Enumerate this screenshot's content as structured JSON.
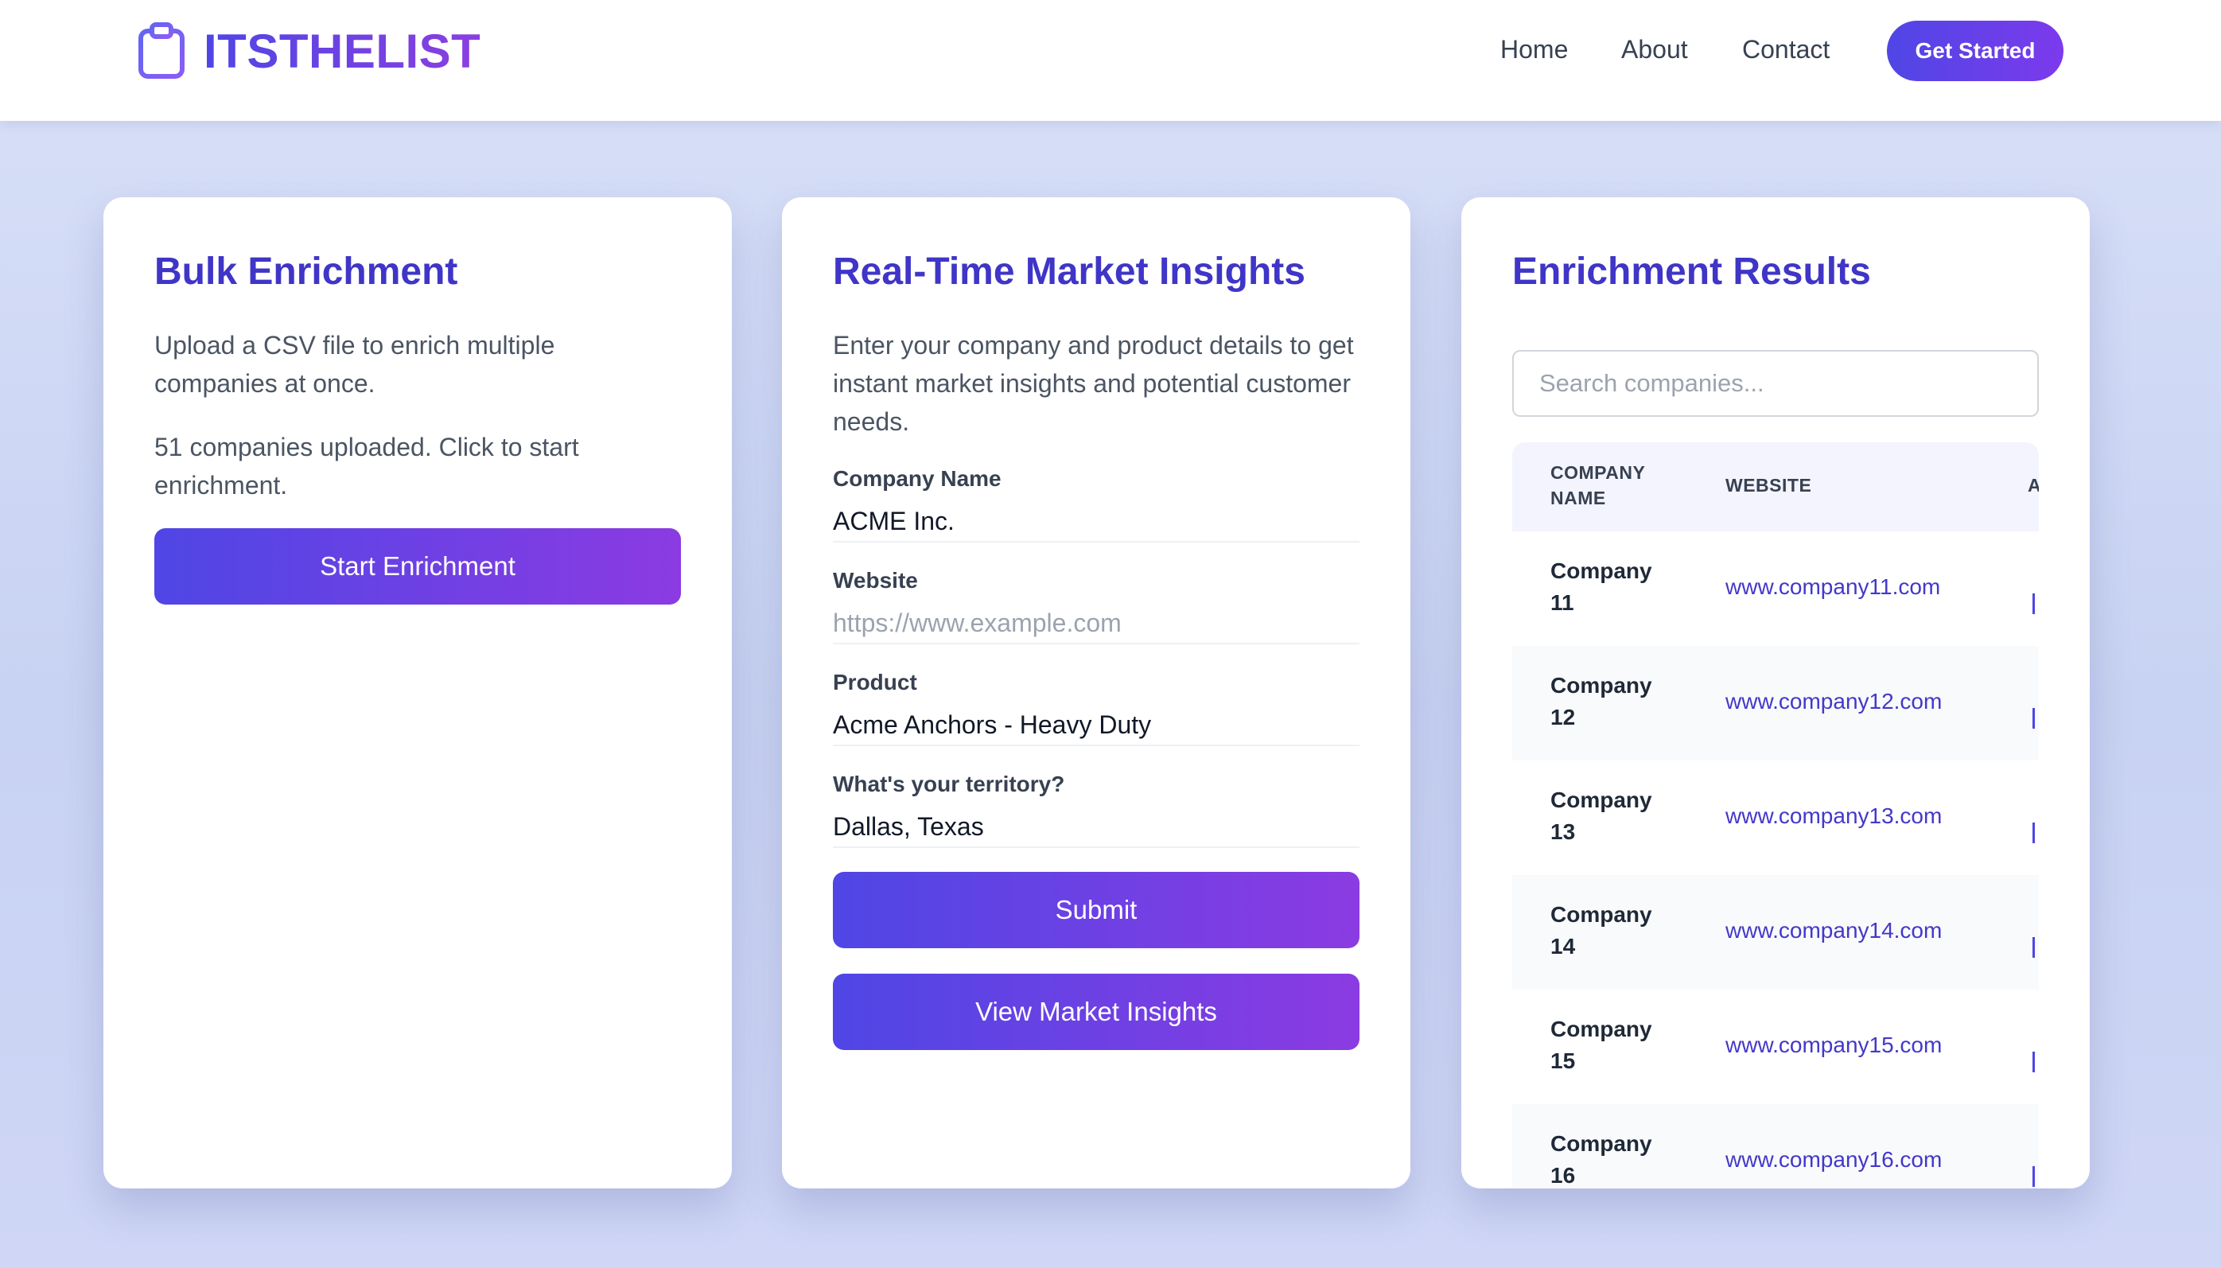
{
  "nav": {
    "brand": "ITSTHELIST",
    "links": [
      "Home",
      "About",
      "Contact"
    ],
    "cta": "Get Started"
  },
  "bulk": {
    "title": "Bulk Enrichment",
    "description": "Upload a CSV file to enrich multiple companies at once.",
    "status": "51 companies uploaded. Click to start enrichment.",
    "button": "Start Enrichment"
  },
  "insights": {
    "title": "Real-Time Market Insights",
    "description": "Enter your company and product details to get instant market insights and potential customer needs.",
    "fields": [
      {
        "label": "Company Name",
        "value": "ACME Inc.",
        "placeholder": ""
      },
      {
        "label": "Website",
        "value": "",
        "placeholder": "https://www.example.com"
      },
      {
        "label": "Product",
        "value": "Acme Anchors - Heavy Duty",
        "placeholder": ""
      },
      {
        "label": "What's your territory?",
        "value": "Dallas, Texas",
        "placeholder": ""
      }
    ],
    "submit": "Submit",
    "view": "View Market Insights"
  },
  "results": {
    "title": "Enrichment Results",
    "search_placeholder": "Search companies...",
    "columns": [
      "Company Name",
      "Website",
      "A"
    ],
    "rows": [
      {
        "name": "Company 11",
        "website": "www.company11.com"
      },
      {
        "name": "Company 12",
        "website": "www.company12.com"
      },
      {
        "name": "Company 13",
        "website": "www.company13.com"
      },
      {
        "name": "Company 14",
        "website": "www.company14.com"
      },
      {
        "name": "Company 15",
        "website": "www.company15.com"
      },
      {
        "name": "Company 16",
        "website": "www.company16.com"
      }
    ]
  },
  "colors": {
    "accent": "#4f46e5",
    "accent_end": "#8b3be2",
    "title": "#3f35c7",
    "link": "#4338ca"
  }
}
